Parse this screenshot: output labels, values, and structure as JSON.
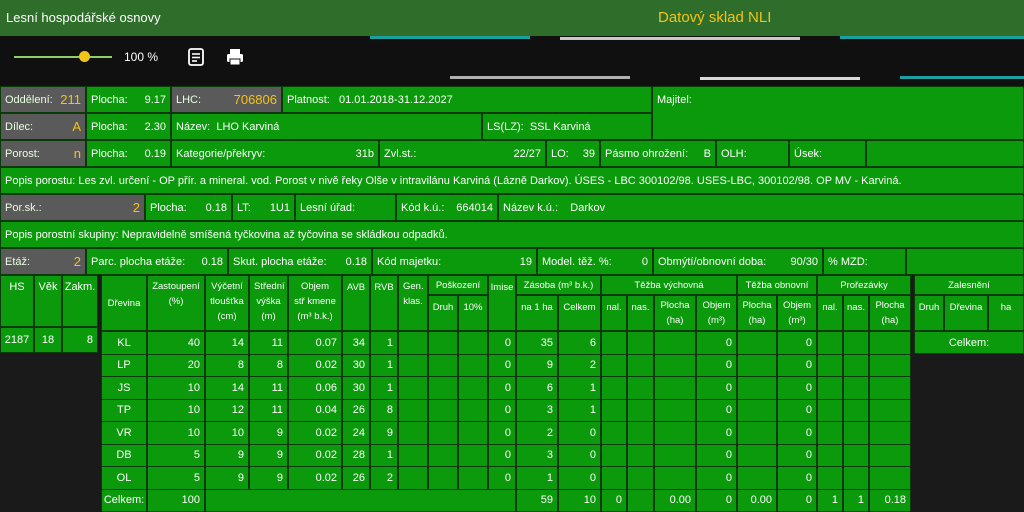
{
  "header": {
    "app_title": "Lesní hospodářské osnovy",
    "brand": "Datový sklad NLI"
  },
  "toolbar": {
    "zoom": "100 %",
    "zoom_level": 0.66,
    "notes_icon": "notes-icon",
    "print_icon": "print-icon"
  },
  "info": {
    "oddeleni_label": "Oddělení:",
    "oddeleni": "211",
    "plocha_label": "Plocha:",
    "plocha1": "9.17",
    "lhc_label": "LHC:",
    "lhc": "706806",
    "platnost_label": "Platnost:",
    "platnost": "01.01.2018-31.12.2027",
    "majitel_label": "Majitel:",
    "dilec_label": "Dílec:",
    "dilec": "A",
    "plocha2": "2.30",
    "nazev_label": "Název:",
    "nazev": "LHO Karviná",
    "lslz_label": "LS(LZ):",
    "lslz": "SSL Karviná",
    "porost_label": "Porost:",
    "porost": "n",
    "plocha3": "0.19",
    "kategorie_label": "Kategorie/překryv:",
    "kategorie": "31b",
    "zvlst_label": "Zvl.st.:",
    "zvlst": "22/27",
    "lo_label": "LO:",
    "lo": "39",
    "pasmo_label": "Pásmo ohrožení:",
    "pasmo": "B",
    "olh_label": "OLH:",
    "usek_label": "Úsek:",
    "popis_porostu_label": "Popis porostu:",
    "popis_porostu": "Les zvl. určení - OP přír. a mineral. vod. Porost v nivě řeky Olše v intravilánu Karviná (Lázně Darkov). ÚSES - LBC 300102/98. USES-LBC, 300102/98. OP MV - Karviná.",
    "porsk_label": "Por.sk.:",
    "porsk": "2",
    "plocha4": "0.18",
    "lt_label": "LT:",
    "lt": "1U1",
    "lesni_urad_label": "Lesní úřad:",
    "kodku_label": "Kód k.ú.:",
    "kodku": "664014",
    "nazevku_label": "Název k.ú.:",
    "nazevku": "Darkov",
    "popis_skupiny_label": "Popis porostní skupiny:",
    "popis_skupiny": "Nepravidelně smíšená tyčkovina až tyčovina se skládkou odpadků.",
    "etaz_label": "Etáž:",
    "etaz": "2",
    "parc_label": "Parc. plocha etáže:",
    "parc": "0.18",
    "skut_label": "Skut. plocha etáže:",
    "skut": "0.18",
    "kodmaj_label": "Kód majetku:",
    "kodmaj": "19",
    "model_label": "Model. těž. %:",
    "model": "0",
    "obmyti_label": "Obmýtí/obnovní doba:",
    "obmyti": "90/30",
    "mzd_label": "% MZD:"
  },
  "hs_table": {
    "headers": [
      "HS",
      "Věk",
      "Zakm."
    ],
    "row": [
      "2187",
      "18",
      "8"
    ]
  },
  "main_table": {
    "headers": {
      "drevina": "Dřevina",
      "zastoupeni1": "Zastoupení",
      "zastoupeni2": "(%)",
      "vycetni1": "Výčetní",
      "vycetni2": "tloušťka",
      "vycetni3": "(cm)",
      "stredni1": "Střední",
      "stredni2": "výška",
      "stredni3": "(m)",
      "objem1": "Objem",
      "objem2": "stř kmene",
      "objem3": "(m³ b.k.)",
      "avb": "AVB",
      "rvb": "RVB",
      "gen1": "Gen.",
      "gen2": "klas.",
      "poskozeni": "Poškození",
      "druh": "Druh",
      "pct10": "10%",
      "imise": "Imise",
      "zasoba": "Zásoba (m³ b.k.)",
      "na1ha": "na 1 ha",
      "celkem": "Celkem",
      "tezba_vych": "Těžba výchovná",
      "tezba_obn": "Těžba obnovní",
      "prorezavky": "Prořezávky",
      "nal": "nal.",
      "nas": "nas.",
      "plocha": "Plocha",
      "ha_unit": "(ha)",
      "objem": "Objem",
      "m3_unit": "(m³)"
    },
    "rows": [
      {
        "drevina": "KL",
        "zast": "40",
        "vt": "14",
        "sv": "11",
        "objem": "0.07",
        "avb": "34",
        "rvb": "1",
        "imise": "0",
        "na1ha": "35",
        "celkem": "6",
        "tv_objem": "0",
        "to_objem": "0"
      },
      {
        "drevina": "LP",
        "zast": "20",
        "vt": "8",
        "sv": "8",
        "objem": "0.02",
        "avb": "30",
        "rvb": "1",
        "imise": "0",
        "na1ha": "9",
        "celkem": "2",
        "tv_objem": "0",
        "to_objem": "0"
      },
      {
        "drevina": "JS",
        "zast": "10",
        "vt": "14",
        "sv": "11",
        "objem": "0.06",
        "avb": "30",
        "rvb": "1",
        "imise": "0",
        "na1ha": "6",
        "celkem": "1",
        "tv_objem": "0",
        "to_objem": "0"
      },
      {
        "drevina": "TP",
        "zast": "10",
        "vt": "12",
        "sv": "11",
        "objem": "0.04",
        "avb": "26",
        "rvb": "8",
        "imise": "0",
        "na1ha": "3",
        "celkem": "1",
        "tv_objem": "0",
        "to_objem": "0"
      },
      {
        "drevina": "VR",
        "zast": "10",
        "vt": "10",
        "sv": "9",
        "objem": "0.02",
        "avb": "24",
        "rvb": "9",
        "imise": "0",
        "na1ha": "2",
        "celkem": "0",
        "tv_objem": "0",
        "to_objem": "0"
      },
      {
        "drevina": "DB",
        "zast": "5",
        "vt": "9",
        "sv": "9",
        "objem": "0.02",
        "avb": "28",
        "rvb": "1",
        "imise": "0",
        "na1ha": "3",
        "celkem": "0",
        "tv_objem": "0",
        "to_objem": "0"
      },
      {
        "drevina": "OL",
        "zast": "5",
        "vt": "9",
        "sv": "9",
        "objem": "0.02",
        "avb": "26",
        "rvb": "2",
        "imise": "0",
        "na1ha": "1",
        "celkem": "0",
        "tv_objem": "0",
        "to_objem": "0"
      }
    ],
    "total": {
      "label": "Celkem:",
      "zast": "100",
      "na1ha": "59",
      "celkem": "10",
      "tv_nal": "0",
      "tv_plocha": "0.00",
      "tv_objem": "0",
      "to_plocha": "0.00",
      "to_objem": "0",
      "pr_nal": "1",
      "pr_nas": "1",
      "pr_plocha": "0.18"
    }
  },
  "zalesneni": {
    "title": "Zalesnění",
    "druh": "Druh",
    "drevina": "Dřevina",
    "ha": "ha",
    "celkem": "Celkem:"
  }
}
